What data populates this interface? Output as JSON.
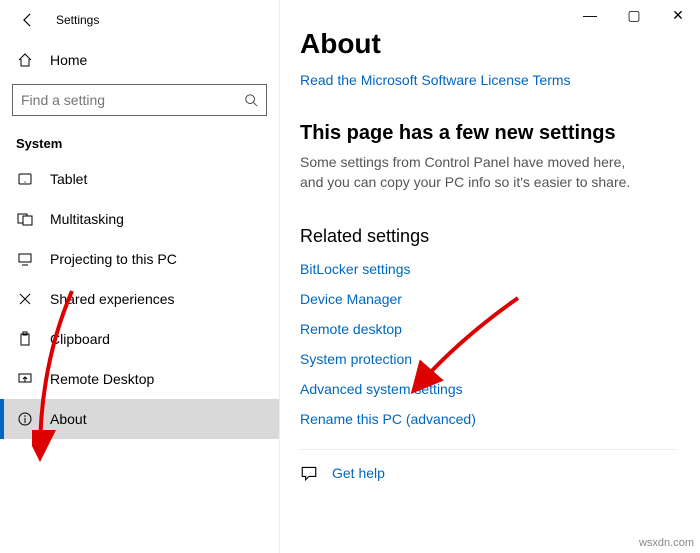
{
  "window": {
    "title": "Settings",
    "controls": {
      "min": "—",
      "max": "▢",
      "close": "✕"
    }
  },
  "sidebar": {
    "home": "Home",
    "search_placeholder": "Find a setting",
    "section": "System",
    "items": [
      {
        "label": "Tablet"
      },
      {
        "label": "Multitasking"
      },
      {
        "label": "Projecting to this PC"
      },
      {
        "label": "Shared experiences"
      },
      {
        "label": "Clipboard"
      },
      {
        "label": "Remote Desktop"
      },
      {
        "label": "About",
        "selected": true
      }
    ]
  },
  "content": {
    "heading": "About",
    "license_link": "Read the Microsoft Software License Terms",
    "new_settings_heading": "This page has a few new settings",
    "new_settings_body": "Some settings from Control Panel have moved here, and you can copy your PC info so it's easier to share.",
    "related_heading": "Related settings",
    "related": [
      "BitLocker settings",
      "Device Manager",
      "Remote desktop",
      "System protection",
      "Advanced system settings",
      "Rename this PC (advanced)"
    ],
    "help": "Get help"
  },
  "watermark": "wsxdn.com"
}
